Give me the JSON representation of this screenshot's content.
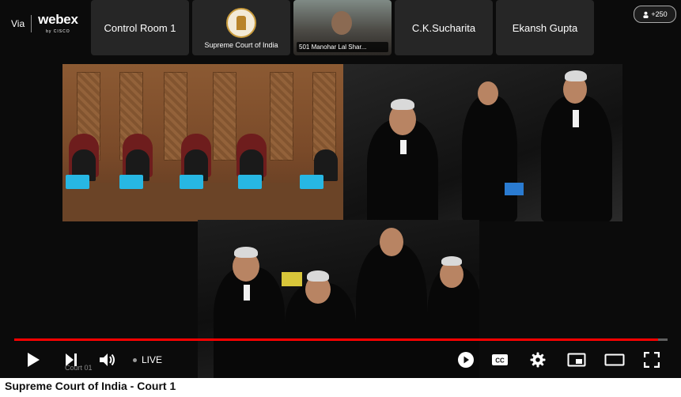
{
  "brand": {
    "via": "Via",
    "logo": "webex",
    "sub": "by CISCO"
  },
  "participants": [
    {
      "label": "Control Room 1"
    },
    {
      "label": "Supreme Court of India"
    },
    {
      "label": "501 Manohar Lal Shar..."
    },
    {
      "label": "C.K.Sucharita"
    },
    {
      "label": "Ekansh Gupta"
    }
  ],
  "participant_count": "+250",
  "player": {
    "live_label": "LIVE",
    "court_tag": "Court 01",
    "progress_fraction": 0.985,
    "accent": "#ff0000"
  },
  "icons": [
    "play-icon",
    "next-icon",
    "volume-icon",
    "autoplay-icon",
    "cc-icon",
    "settings-icon",
    "miniplayer-icon",
    "theater-icon",
    "fullscreen-icon"
  ],
  "video_title": "Supreme Court of India - Court 1"
}
